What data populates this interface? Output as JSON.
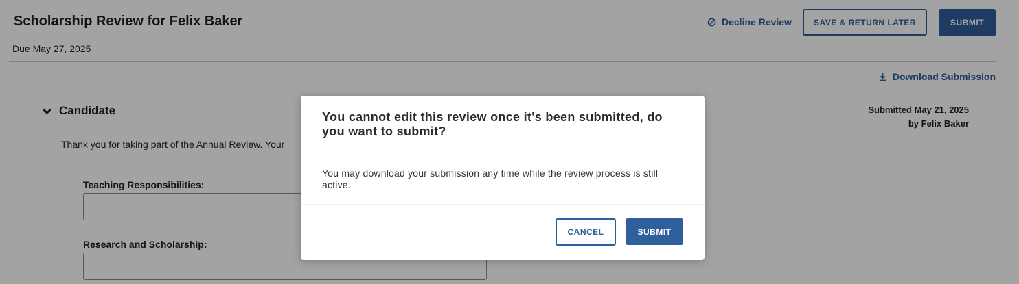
{
  "header": {
    "title": "Scholarship Review for Felix Baker",
    "due": "Due May 27, 2025",
    "decline_label": "Decline Review",
    "save_label": "SAVE & RETURN LATER",
    "submit_label": "SUBMIT"
  },
  "download_label": "Download Submission",
  "section": {
    "title": "Candidate",
    "submitted_line1": "Submitted May 21, 2025",
    "submitted_line2": "by Felix Baker",
    "intro": "Thank you for taking part of the Annual Review. Your",
    "fields": [
      {
        "label": "Teaching Responsibilities:"
      },
      {
        "label": "Research and Scholarship:"
      }
    ]
  },
  "modal": {
    "title": "You cannot edit this review once it's been submitted, do you want to submit?",
    "body": "You may download your submission any time while the review process is still active.",
    "cancel_label": "CANCEL",
    "submit_label": "SUBMIT"
  },
  "colors": {
    "accent": "#2f5f9c",
    "overlay": "rgba(0,0,0,0.36)"
  },
  "icons": [
    "ban-icon",
    "download-icon",
    "chevron-down-icon"
  ]
}
